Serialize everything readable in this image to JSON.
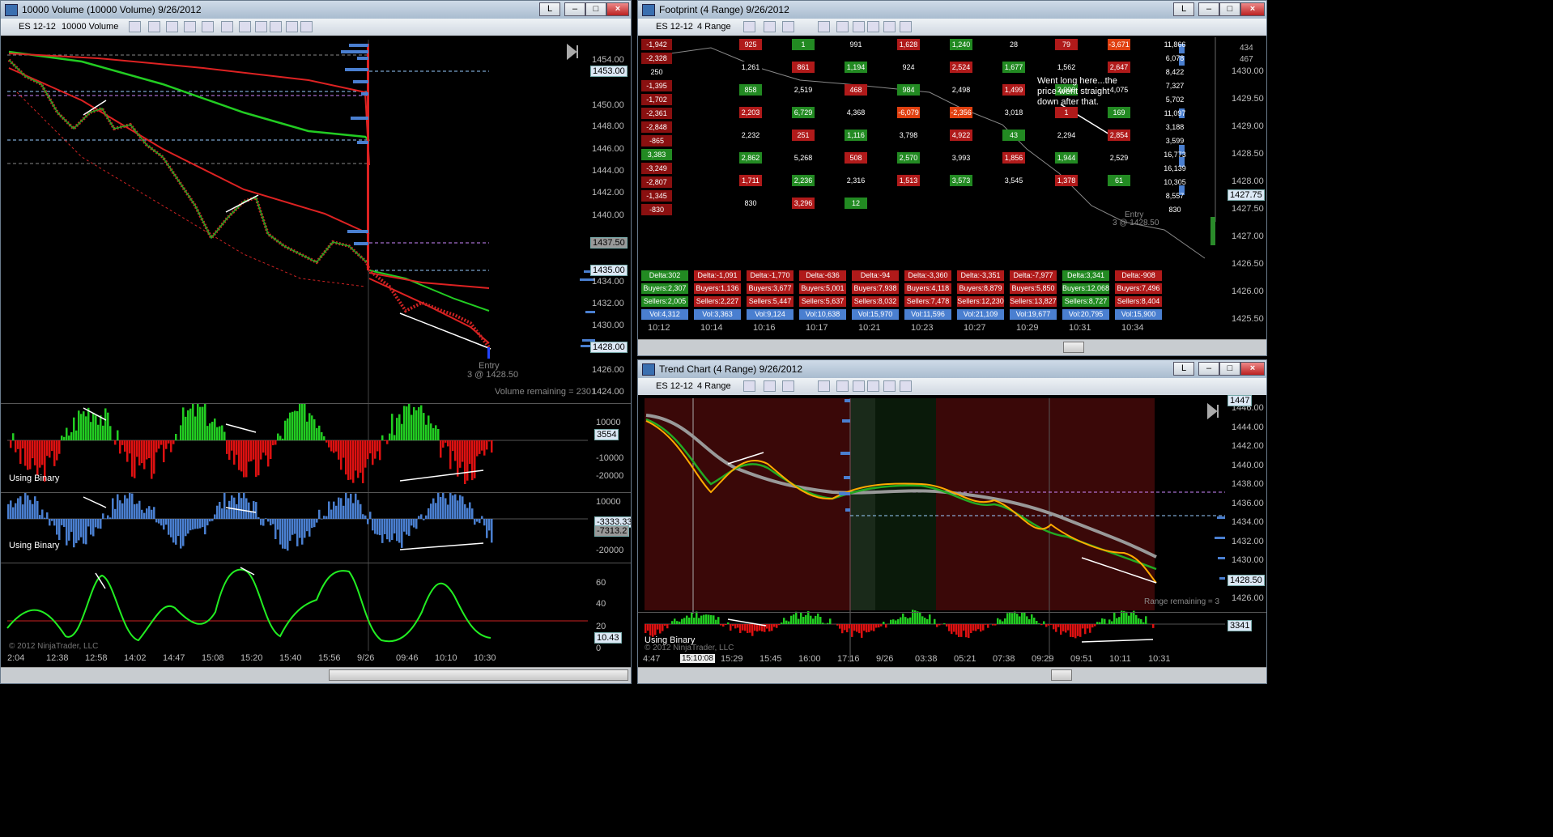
{
  "colors": {
    "up": "#22cc22",
    "down": "#dd1111",
    "volume": "#4a7fd0",
    "osc": "#22ee22",
    "titlebar": "#b8c9db"
  },
  "left": {
    "title": "10000 Volume (10000 Volume)  9/26/2012",
    "instrument": "ES 12-12",
    "period": "10000 Volume",
    "price_ticks": [
      "1454.00",
      "1452.00",
      "1450.00",
      "1448.00",
      "1446.00",
      "1444.00",
      "1442.00",
      "1440.00",
      "1438.00",
      "1436.00",
      "1434.00",
      "1432.00",
      "1430.00",
      "1428.00",
      "1426.00",
      "1424.00"
    ],
    "price_labels": [
      "1453.00",
      "1437.50",
      "1435.00",
      "1428.00"
    ],
    "entry_label": "Entry",
    "entry_detail": "3 @ 1428.50",
    "volume_remaining": "Volume remaining = 2301",
    "panel1_ticks": [
      "10000",
      "-10000",
      "-20000"
    ],
    "panel1_value": "3554",
    "panel1_label": "Using Binary",
    "panel2_ticks": [
      "10000",
      "-20000"
    ],
    "panel2_values": [
      "-3333.33",
      "-7313.2"
    ],
    "panel2_label": "Using Binary",
    "panel3_ticks": [
      "60",
      "40",
      "20",
      "0"
    ],
    "panel3_value": "10.43",
    "copyright": "© 2012 NinjaTrader, LLC",
    "time_ticks": [
      "2:04",
      "12:38",
      "12:58",
      "14:02",
      "14:47",
      "15:08",
      "15:20",
      "15:40",
      "15:56",
      "9/26",
      "09:46",
      "10:10",
      "10:30"
    ]
  },
  "footprint": {
    "title": "Footprint (4 Range)  9/26/2012",
    "instrument": "ES 12-12",
    "period": "4 Range",
    "corner_values": [
      "434",
      "467"
    ],
    "price_ticks": [
      "1430.00",
      "1429.50",
      "1429.00",
      "1428.50",
      "1428.00",
      "1427.50",
      "1427.00",
      "1426.50",
      "1426.00",
      "1425.50"
    ],
    "price_label": "1427.75",
    "annotation": "Went long here...the price went straight down after that.",
    "entry_label": "Entry",
    "entry_detail": "3 @ 1428.50",
    "left_column": [
      "-1,942",
      "-2,328",
      "250",
      "-1,395",
      "-1,702",
      "-2,361",
      "-2,848",
      "-865",
      "3,383",
      "-3,249",
      "-2,807",
      "-1,345",
      "-830"
    ],
    "right_column": [
      "11,866",
      "6,078",
      "8,422",
      "7,327",
      "5,702",
      "11,097",
      "3,188",
      "3,599",
      "16,773",
      "16,139",
      "10,305",
      "8,557",
      "830"
    ],
    "misc_cells": [
      "925",
      "1",
      "991",
      "1,628",
      "1,240",
      "28",
      "79",
      "-3,671",
      "1,261",
      "861",
      "1,194",
      "924",
      "2,524",
      "1,677",
      "1,562",
      "2,647",
      "858",
      "2,519",
      "468",
      "984",
      "2,498",
      "1,499",
      "2,000",
      "4,075",
      "2,203",
      "6,729",
      "4,368",
      "-6,079",
      "-2,356",
      "3,018",
      "1",
      "169",
      "2,232",
      "251",
      "1,116",
      "3,798",
      "4,922",
      "43",
      "2,294",
      "2,854",
      "2,862",
      "5,268",
      "508",
      "2,570",
      "3,993",
      "1,856",
      "1,944",
      "2,529",
      "1,711",
      "2,236",
      "2,316",
      "1,513",
      "3,573",
      "3,545",
      "1,378",
      "61",
      "830",
      "3,296",
      "12"
    ],
    "delta": [
      "Delta:302",
      "Delta:-1,091",
      "Delta:-1,770",
      "Delta:-636",
      "Delta:-94",
      "Delta:-3,360",
      "Delta:-3,351",
      "Delta:-7,977",
      "Delta:3,341",
      "Delta:-908"
    ],
    "buyers": [
      "Buyers:2,307",
      "Buyers:1,136",
      "Buyers:3,677",
      "Buyers:5,001",
      "Buyers:7,938",
      "Buyers:4,118",
      "Buyers:8,879",
      "Buyers:5,850",
      "Buyers:12,068",
      "Buyers:7,496"
    ],
    "sellers": [
      "Sellers:2,005",
      "Sellers:2,227",
      "Sellers:5,447",
      "Sellers:5,637",
      "Sellers:8,032",
      "Sellers:7,478",
      "Sellers:12,230",
      "Sellers:13,827",
      "Sellers:8,727",
      "Sellers:8,404"
    ],
    "vol": [
      "Vol:4,312",
      "Vol:3,363",
      "Vol:9,124",
      "Vol:10,638",
      "Vol:15,970",
      "Vol:11,596",
      "Vol:21,109",
      "Vol:19,677",
      "Vol:20,795",
      "Vol:15,900"
    ],
    "time_ticks": [
      "10:12",
      "10:14",
      "10:16",
      "10:17",
      "10:21",
      "10:23",
      "10:27",
      "10:29",
      "10:31",
      "10:34"
    ]
  },
  "trend": {
    "title": "Trend Chart (4 Range)  9/26/2012",
    "instrument": "ES 12-12",
    "period": "4 Range",
    "price_ticks": [
      "1446.00",
      "1444.00",
      "1442.00",
      "1440.00",
      "1438.00",
      "1436.00",
      "1434.00",
      "1432.00",
      "1430.00",
      "1428.00",
      "1426.00"
    ],
    "price_labels": [
      "1447",
      "1428.50"
    ],
    "range_remaining": "Range remaining = 3",
    "panel_value": "3341",
    "panel_label": "Using Binary",
    "copyright": "© 2012 NinjaTrader, LLC",
    "cursor_time": "15:10:08",
    "time_ticks": [
      "4:47",
      "15:12",
      "15:29",
      "15:45",
      "16:00",
      "17:16",
      "9/26",
      "03:38",
      "05:21",
      "07:38",
      "09:29",
      "09:51",
      "10:11",
      "10:31"
    ]
  },
  "window_buttons": {
    "link": "L",
    "min": "–",
    "max": "□",
    "close": "×"
  }
}
